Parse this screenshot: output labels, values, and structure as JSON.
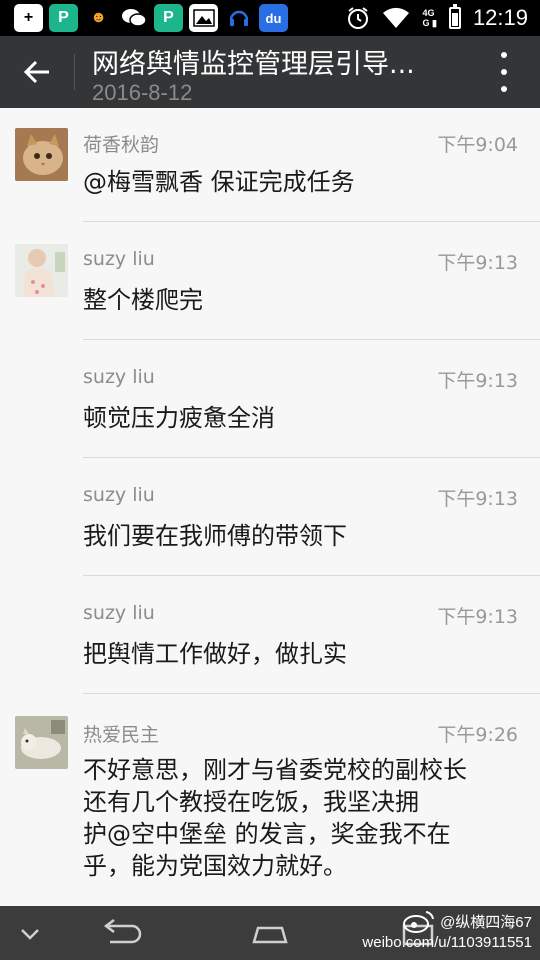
{
  "status_bar": {
    "time": "12:19",
    "network": "4G",
    "apps": [
      {
        "icon": "plus-app-icon",
        "glyph": "+",
        "bg": "#ffffff",
        "fg": "#000000"
      },
      {
        "icon": "p-app-icon",
        "glyph": "P",
        "bg": "#1db58b",
        "fg": "#ffffff"
      },
      {
        "icon": "uc-browser-icon",
        "glyph": "☻",
        "bg": "#000000",
        "fg": "#f2a12b"
      },
      {
        "icon": "wechat-icon",
        "glyph": "●",
        "bg": "#000000",
        "fg": "#ffffff"
      },
      {
        "icon": "p-app-icon",
        "glyph": "P",
        "bg": "#1db58b",
        "fg": "#ffffff"
      },
      {
        "icon": "image-icon",
        "glyph": "▲",
        "bg": "#ffffff",
        "fg": "#000000"
      },
      {
        "icon": "headset-icon",
        "glyph": "♪",
        "bg": "#000000",
        "fg": "#ffffff"
      },
      {
        "icon": "baidu-icon",
        "glyph": "du",
        "bg": "#2a6ee6",
        "fg": "#ffffff"
      }
    ]
  },
  "header": {
    "title": "网络舆情监控管理层引导...",
    "subtitle": "2016-8-12"
  },
  "messages": [
    {
      "sender": "荷香秋韵",
      "time": "下午9:04",
      "text": "@梅雪飘香 保证完成任务",
      "avatar": "cat-avatar"
    },
    {
      "sender": "suzy liu",
      "time": "下午9:13",
      "text": "整个楼爬完",
      "avatar": "child-avatar"
    },
    {
      "sender": "suzy liu",
      "time": "下午9:13",
      "text": "顿觉压力疲惫全消",
      "avatar": ""
    },
    {
      "sender": "suzy liu",
      "time": "下午9:13",
      "text": "我们要在我师傅的带领下",
      "avatar": ""
    },
    {
      "sender": "suzy liu",
      "time": "下午9:13",
      "text": "把舆情工作做好，做扎实",
      "avatar": ""
    },
    {
      "sender": "热爱民主",
      "time": "下午9:26",
      "lines": [
        "不好意思，刚才与省委党校的副校长",
        "还有几个教授在吃饭，我坚决拥",
        "护@空中堡垒 的发言，奖金我不在",
        "乎，能为党国效力就好。"
      ],
      "avatar": "animal-avatar"
    }
  ],
  "watermark": {
    "handle": "@纵横四海67",
    "url": "weibo.com/u/1103911551"
  },
  "colors": {
    "action_bar": "#333537",
    "background": "#f7f7f7",
    "nav_bar": "#3c3c3c"
  }
}
